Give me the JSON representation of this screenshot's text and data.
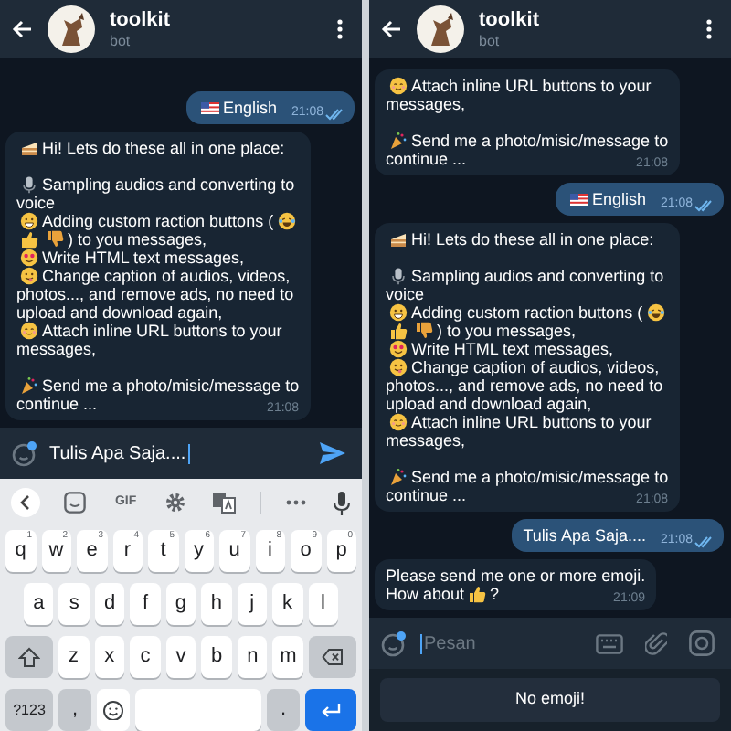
{
  "screens": [
    {
      "header": {
        "title": "toolkit",
        "subtitle": "bot"
      },
      "messages": [
        {
          "kind": "out",
          "paragraphs": [
            [
              [
                {
                  "kind": "flag"
                },
                "English"
              ]
            ]
          ],
          "time": "21:08",
          "read": true
        },
        {
          "kind": "in",
          "paragraphs": [
            [
              [
                {
                  "kind": "cake"
                },
                "Hi! Lets do these all in one place:"
              ]
            ],
            [
              [
                {
                  "kind": "mic"
                },
                "Sampling audios and converting to"
              ],
              [
                "voice"
              ],
              [
                {
                  "kind": "grin"
                },
                "Adding custom raction buttons (",
                {
                  "kind": "laugh"
                }
              ],
              [
                {
                  "kind": "thumbs-up"
                },
                {
                  "kind": "thumbs-down"
                },
                ") to you messages,"
              ],
              [
                {
                  "kind": "heart-eyes"
                },
                "Write HTML text messages,"
              ],
              [
                {
                  "kind": "yum"
                },
                "Change caption of audios, videos,"
              ],
              [
                "photos..., and remove ads, no need to"
              ],
              [
                "upload and download again,"
              ],
              [
                {
                  "kind": "blush"
                },
                "Attach inline URL buttons to your"
              ],
              [
                "messages,"
              ]
            ],
            [
              [
                {
                  "kind": "party"
                },
                "Send me a photo/misic/message to"
              ],
              [
                "continue ..."
              ]
            ]
          ],
          "time": "21:08"
        }
      ],
      "composer": {
        "value": "Tulis Apa Saja....",
        "focused": true,
        "sticker_badge": true,
        "buttons": [
          {
            "kind": "send"
          }
        ]
      },
      "keyboard": {
        "toolbar": [
          {
            "kind": "back"
          },
          {
            "kind": "sticker"
          },
          {
            "kind": "label",
            "label": "GIF"
          },
          {
            "kind": "gear"
          },
          {
            "kind": "translate"
          },
          {
            "kind": "more"
          },
          {
            "kind": "mic"
          }
        ],
        "rows": [
          {
            "keys": [
              {
                "label": "q",
                "hint": "1"
              },
              {
                "label": "w",
                "hint": "2"
              },
              {
                "label": "e",
                "hint": "3"
              },
              {
                "label": "r",
                "hint": "4"
              },
              {
                "label": "t",
                "hint": "5"
              },
              {
                "label": "y",
                "hint": "6"
              },
              {
                "label": "u",
                "hint": "7"
              },
              {
                "label": "i",
                "hint": "8"
              },
              {
                "label": "o",
                "hint": "9"
              },
              {
                "label": "p",
                "hint": "0"
              }
            ]
          },
          {
            "keys": [
              {
                "label": "a"
              },
              {
                "label": "s"
              },
              {
                "label": "d"
              },
              {
                "label": "f"
              },
              {
                "label": "g"
              },
              {
                "label": "h"
              },
              {
                "label": "j"
              },
              {
                "label": "k"
              },
              {
                "label": "l"
              }
            ]
          },
          {
            "keys": [
              {
                "kind": "shift"
              },
              {
                "label": "z"
              },
              {
                "label": "x"
              },
              {
                "label": "c"
              },
              {
                "label": "v"
              },
              {
                "label": "b"
              },
              {
                "label": "n"
              },
              {
                "label": "m"
              },
              {
                "kind": "backspace"
              }
            ]
          },
          {
            "keys": [
              {
                "kind": "special",
                "label": "?123"
              },
              {
                "kind": "special",
                "label": ","
              },
              {
                "kind": "emoji"
              },
              {
                "kind": "space"
              },
              {
                "kind": "special",
                "label": "."
              },
              {
                "kind": "enter"
              }
            ]
          }
        ]
      }
    },
    {
      "header": {
        "title": "toolkit",
        "subtitle": "bot"
      },
      "messages": [
        {
          "kind": "in",
          "paragraphs": [
            [
              [
                {
                  "kind": "blush"
                },
                "Attach inline URL buttons to your"
              ],
              [
                "messages,"
              ]
            ],
            [
              [
                {
                  "kind": "party"
                },
                "Send me a photo/misic/message to"
              ],
              [
                "continue ..."
              ]
            ]
          ],
          "time": "21:08"
        },
        {
          "kind": "out",
          "paragraphs": [
            [
              [
                {
                  "kind": "flag"
                },
                "English"
              ]
            ]
          ],
          "time": "21:08",
          "read": true
        },
        {
          "kind": "in",
          "paragraphs": [
            [
              [
                {
                  "kind": "cake"
                },
                "Hi! Lets do these all in one place:"
              ]
            ],
            [
              [
                {
                  "kind": "mic"
                },
                "Sampling audios and converting to"
              ],
              [
                "voice"
              ],
              [
                {
                  "kind": "grin"
                },
                "Adding custom raction buttons (",
                {
                  "kind": "laugh"
                }
              ],
              [
                {
                  "kind": "thumbs-up"
                },
                {
                  "kind": "thumbs-down"
                },
                ") to you messages,"
              ],
              [
                {
                  "kind": "heart-eyes"
                },
                "Write HTML text messages,"
              ],
              [
                {
                  "kind": "yum"
                },
                "Change caption of audios, videos,"
              ],
              [
                "photos..., and remove ads, no need to"
              ],
              [
                "upload and download again,"
              ],
              [
                {
                  "kind": "blush"
                },
                "Attach inline URL buttons to your"
              ],
              [
                "messages,"
              ]
            ],
            [
              [
                {
                  "kind": "party"
                },
                "Send me a photo/misic/message to"
              ],
              [
                "continue ..."
              ]
            ]
          ],
          "time": "21:08"
        },
        {
          "kind": "out",
          "paragraphs": [
            [
              [
                "Tulis Apa Saja...."
              ]
            ]
          ],
          "time": "21:08",
          "read": true
        },
        {
          "kind": "in",
          "paragraphs": [
            [
              [
                "Please send me one or more emoji."
              ],
              [
                "How about",
                {
                  "kind": "thumbs-up"
                },
                "?"
              ]
            ]
          ],
          "time": "21:09"
        }
      ],
      "composer": {
        "placeholder": "Pesan",
        "focused": true,
        "sticker_badge": true,
        "buttons": [
          {
            "kind": "keyboard"
          },
          {
            "kind": "attach"
          },
          {
            "kind": "camera"
          }
        ]
      },
      "reply_keyboard": {
        "buttons": [
          "No emoji!"
        ]
      }
    }
  ]
}
